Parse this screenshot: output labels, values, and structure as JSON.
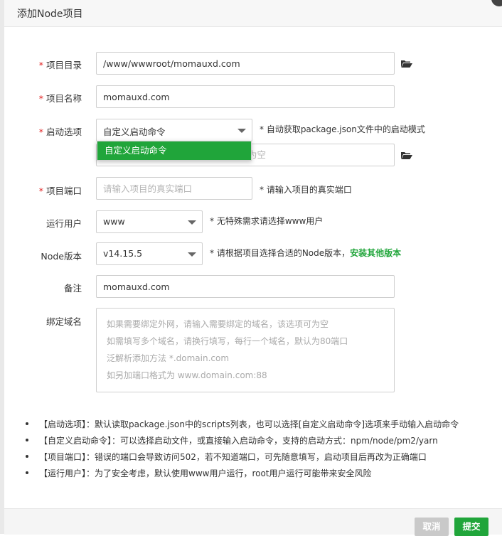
{
  "dialog": {
    "title": "添加Node项目"
  },
  "form": {
    "dir": {
      "label": "项目目录",
      "required": "*",
      "value": "/www/wwwroot/momauxd.com"
    },
    "name": {
      "label": "项目名称",
      "required": "*",
      "value": "momauxd.com"
    },
    "start": {
      "label": "启动选项",
      "required": "*",
      "selected": "自定义启动命令",
      "hint": "* 自动获取package.json文件中的启动模式",
      "dropdown_option": "自定义启动命令",
      "cmd_placeholder_tail": "为空"
    },
    "port": {
      "label": "项目端口",
      "required": "*",
      "placeholder": "请输入项目的真实端口",
      "hint": "* 请输入项目的真实端口"
    },
    "user": {
      "label": "运行用户",
      "selected": "www",
      "hint": "* 无特殊需求请选择www用户"
    },
    "node": {
      "label": "Node版本",
      "selected": "v14.15.5",
      "hint": "* 请根据项目选择合适的Node版本，",
      "link": "安装其他版本"
    },
    "remark": {
      "label": "备注",
      "value": "momauxd.com"
    },
    "domain": {
      "label": "绑定域名",
      "placeholder_lines": [
        "如果需要绑定外网，请输入需要绑定的域名，该选项可为空",
        "如需填写多个域名，请换行填写，每行一个域名，默认为80端口",
        "泛解析添加方法 *.domain.com",
        "如另加端口格式为 www.domain.com:88"
      ]
    }
  },
  "notes": [
    "【启动选项】：默认读取package.json中的scripts列表，也可以选择[自定义启动命令]选项来手动输入启动命令",
    "【自定义启动命令】：可以选择启动文件，或直接输入启动命令，支持的启动方式：npm/node/pm2/yarn",
    "【项目端口】：错误的端口会导致访问502，若不知道端口，可先随意填写，启动项目后再改为正确端口",
    "【运行用户】：为了安全考虑，默认使用www用户运行，root用户运行可能带来安全风险"
  ],
  "footer": {
    "cancel": "取消",
    "submit": "提交"
  },
  "icons": {
    "dir_picker": "folder-open-icon",
    "cmd_picker": "folder-open-icon"
  }
}
